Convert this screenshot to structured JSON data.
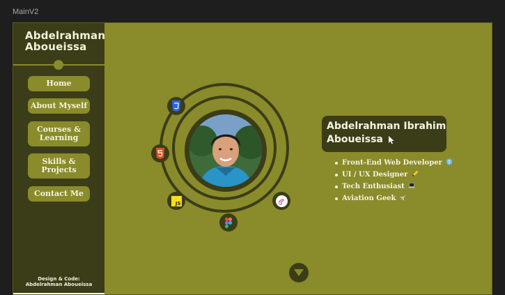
{
  "frame": {
    "title": "MainV2"
  },
  "sidebar": {
    "brand_line1": "Abdelrahman",
    "brand_line2": "Aboueissa",
    "nav": [
      {
        "label": "Home"
      },
      {
        "label": "About Myself"
      },
      {
        "label_line1": "Courses &",
        "label_line2": "Learning"
      },
      {
        "label_line1": "Skills &",
        "label_line2": "Projects"
      },
      {
        "label": "Contact Me"
      }
    ],
    "credit_line1": "Design & Code:",
    "credit_line2": "Abdelrahman Aboueissa"
  },
  "hero": {
    "name_line1": "Abdelrahman Ibrahim",
    "name_line2": "Aboueissa",
    "roles": [
      {
        "text": "Front-End Web Developer",
        "emoji": "globe-icon"
      },
      {
        "text": "UI / UX Designer",
        "emoji": "pencil-icon"
      },
      {
        "text": "Tech Enthusiast",
        "emoji": "laptop-icon"
      },
      {
        "text": "Aviation Geek",
        "emoji": "airplane-icon"
      }
    ],
    "tech_icons": [
      "css3-icon",
      "html5-icon",
      "javascript-icon",
      "figma-icon",
      "sass-icon"
    ],
    "tech_labels": {
      "js": "JS"
    }
  },
  "colors": {
    "frame_bg": "#8a8b2a",
    "sidebar_bg": "#3b3d18",
    "text_light": "#f4f4e2"
  }
}
